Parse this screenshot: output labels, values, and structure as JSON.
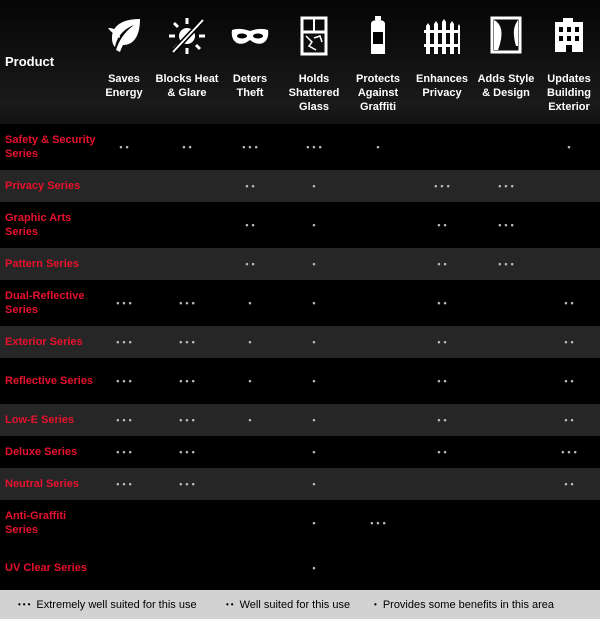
{
  "header": {
    "product_label": "Product",
    "columns": [
      {
        "label": "Saves Energy",
        "icon": "leaf-icon"
      },
      {
        "label": "Blocks Heat & Glare",
        "icon": "sun-blocked-icon"
      },
      {
        "label": "Deters Theft",
        "icon": "bandit-mask-icon"
      },
      {
        "label": "Holds Shattered Glass",
        "icon": "shattered-window-icon"
      },
      {
        "label": "Protects Against Graffiti",
        "icon": "spray-can-icon"
      },
      {
        "label": "Enhances Privacy",
        "icon": "fence-icon"
      },
      {
        "label": "Adds Style & Design",
        "icon": "curtain-window-icon"
      },
      {
        "label": "Updates Building Exterior",
        "icon": "building-icon"
      }
    ]
  },
  "rows": [
    {
      "name": "Safety & Security Series",
      "ratings": [
        "••",
        "••",
        "•••",
        "•••",
        "•",
        "",
        "",
        "•"
      ]
    },
    {
      "name": "Privacy Series",
      "ratings": [
        "",
        "",
        "••",
        "•",
        "",
        "•••",
        "•••",
        ""
      ]
    },
    {
      "name": "Graphic Arts Series",
      "ratings": [
        "",
        "",
        "••",
        "•",
        "",
        "••",
        "•••",
        ""
      ]
    },
    {
      "name": "Pattern Series",
      "ratings": [
        "",
        "",
        "••",
        "•",
        "",
        "••",
        "•••",
        ""
      ]
    },
    {
      "name": "Dual-Reflective Series",
      "ratings": [
        "•••",
        "•••",
        "•",
        "•",
        "",
        "••",
        "",
        "••"
      ]
    },
    {
      "name": "Exterior Series",
      "ratings": [
        "•••",
        "•••",
        "•",
        "•",
        "",
        "••",
        "",
        "••"
      ]
    },
    {
      "name": "Reflective Series",
      "ratings": [
        "•••",
        "•••",
        "•",
        "•",
        "",
        "••",
        "",
        "••"
      ]
    },
    {
      "name": "Low-E Series",
      "ratings": [
        "•••",
        "•••",
        "•",
        "•",
        "",
        "••",
        "",
        "••"
      ]
    },
    {
      "name": "Deluxe Series",
      "ratings": [
        "•••",
        "•••",
        "",
        "•",
        "",
        "••",
        "",
        "•••"
      ]
    },
    {
      "name": "Neutral Series",
      "ratings": [
        "•••",
        "•••",
        "",
        "•",
        "",
        "",
        "",
        "••"
      ]
    },
    {
      "name": "Anti-Graffiti Series",
      "ratings": [
        "",
        "",
        "",
        "•",
        "•••",
        "",
        "",
        ""
      ]
    },
    {
      "name": "UV Clear Series",
      "ratings": [
        "",
        "",
        "",
        "•",
        "",
        "",
        "",
        ""
      ]
    }
  ],
  "legend": [
    {
      "dots": "•••",
      "text": "Extremely well suited for this use"
    },
    {
      "dots": "••",
      "text": "Well suited for this use"
    },
    {
      "dots": "•",
      "text": "Provides some benefits in this area"
    }
  ],
  "colors": {
    "row_label": "#e8112d",
    "alt_row": "#262626",
    "dot": "#b9b9b9",
    "legend_bg": "#d2d2d2"
  }
}
